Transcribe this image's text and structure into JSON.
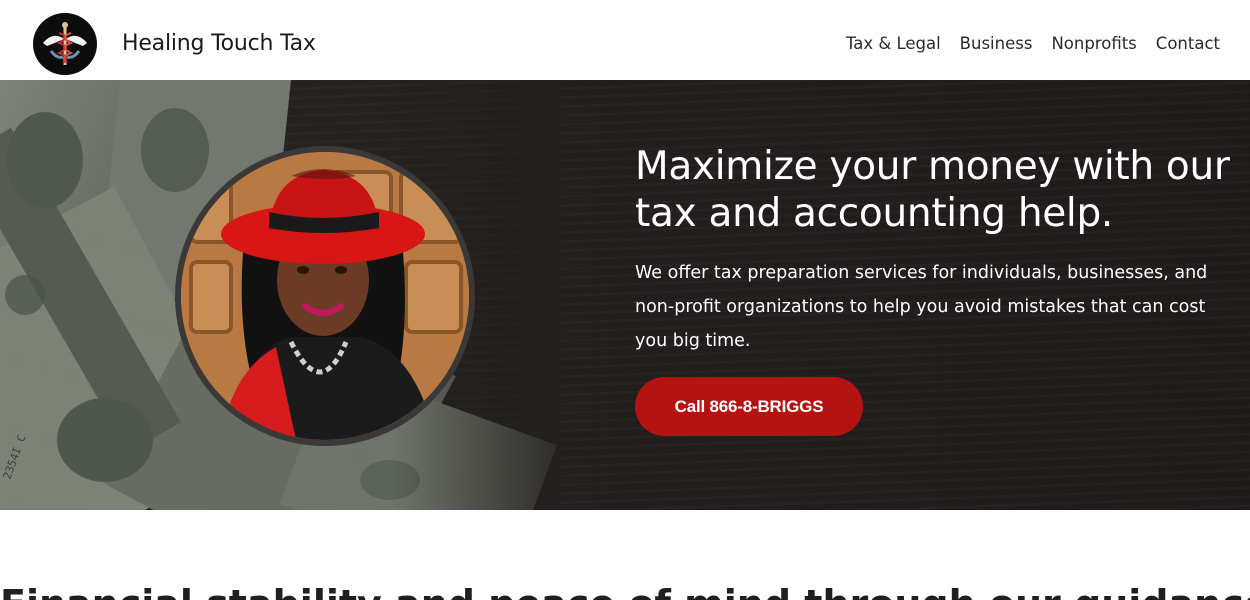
{
  "header": {
    "brand": "Healing Touch Tax",
    "logo_icon": "caduceus-logo-icon",
    "nav": [
      {
        "label": "Tax & Legal"
      },
      {
        "label": "Business"
      },
      {
        "label": "Nonprofits"
      },
      {
        "label": "Contact"
      }
    ]
  },
  "hero": {
    "headline": "Maximize your money with our tax and accounting help.",
    "subtext": "We offer tax preparation services for individuals, businesses, and non-profit organizations to help you avoid mistakes that can cost you big time.",
    "cta_label": "Call 866-8-BRIGGS",
    "colors": {
      "cta_bg": "#b51212",
      "hero_bg": "#231f1e"
    }
  },
  "section": {
    "title": "Financial stability and peace of mind through our guidance."
  }
}
